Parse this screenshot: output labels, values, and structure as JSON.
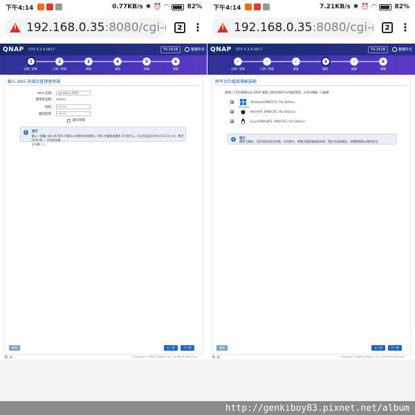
{
  "watermark": "http://genkiboy83.pixnet.net/album",
  "left": {
    "status": {
      "time": "下午4:14",
      "speed": "0.77KB/s",
      "battery": "82%"
    },
    "url": {
      "host": "192.168.0.35",
      "rest": ":8080/cgi-bi",
      "tabs": "2",
      "menu": "⋮"
    },
    "qnap": {
      "logo": "QNAP",
      "version": "QTS 4.3.4.0617",
      "model": "TS-251B",
      "lang": "繁體中文"
    },
    "steps": [
      {
        "num": "1",
        "label": "名稱 / 密碼"
      },
      {
        "num": "2",
        "label": "日期 / 時間"
      },
      {
        "num": "3",
        "label": "網路"
      },
      {
        "num": "4",
        "label": "服務"
      },
      {
        "num": "5",
        "label": "磁碟"
      },
      {
        "num": "6",
        "label": "摘要"
      }
    ],
    "title": "輸入 NAS 名稱及管理者密碼",
    "fields": [
      {
        "label": "NAS 名稱 :",
        "value": "genkiboy-2669"
      },
      {
        "label": "使用者名稱 :",
        "value": "admin"
      },
      {
        "label": "密碼 :",
        "value": "•••••"
      },
      {
        "label": "確認密碼 :",
        "value": "•••••"
      }
    ],
    "show_password": "顯示密碼",
    "tip": {
      "title": "提示",
      "text1": "輸入一個獨一無二的 NAS 名稱可以的更有效地識別。NAS 名稱長度最多 14 個字元，可以包含英文字母 (A-Z 及 a-z)、數字 (0-9) 和 -，不允許空格",
      "text2": "及句點 (.)。"
    },
    "buttons": {
      "cancel": "取消",
      "prev": "上一步",
      "next": "下一步"
    },
    "copyright": "Copyright © QNAP Systems, Inc. All Rights Reserved."
  },
  "right": {
    "status": {
      "time": "下午4:14",
      "speed": "7.21KB/s",
      "battery": "82%"
    },
    "url": {
      "host": "192.168.0.35",
      "rest": ":8080/cgi-bi",
      "tabs": "2",
      "menu": "⋮"
    },
    "qnap": {
      "logo": "QNAP",
      "version": "QTS 4.3.4.0617",
      "model": "TS-251B",
      "lang": "繁體中文"
    },
    "steps": [
      {
        "num": "✓",
        "label": "名稱 / 密碼"
      },
      {
        "num": "✓",
        "label": "日期 / 時間"
      },
      {
        "num": "✓",
        "label": "網路"
      },
      {
        "num": "4",
        "label": "服務"
      },
      {
        "num": "✓",
        "label": "磁碟"
      },
      {
        "num": "6",
        "label": "摘要"
      }
    ],
    "title": "跨平台的檔案傳輸服務",
    "subtitle": "選擇以下您所需要在此 QNAP 裝置上使用的跨平台的檔案管理，分享與傳輸（可複選）：",
    "os": [
      {
        "name": "Windows(SMB/CIFS, File Station)",
        "caption": "Windows"
      },
      {
        "name": "Mac(AFP, SMB/CIFS, File Station)",
        "caption": ""
      },
      {
        "name": "Linux/UNIX(NFS, SMB/CIFS, File Station)",
        "caption": ""
      }
    ],
    "tip": {
      "title": "提示",
      "text": "選擇之服務，可於系統初始完成後，在控制台、網路及檔案服務區修改。請在完成後確認，並關閉服務以確保安全。"
    },
    "buttons": {
      "cancel": "取消",
      "prev": "上一步",
      "next": "下一步"
    },
    "copyright": "Copyright © QNAP Systems, Inc. All Rights Reserved."
  }
}
